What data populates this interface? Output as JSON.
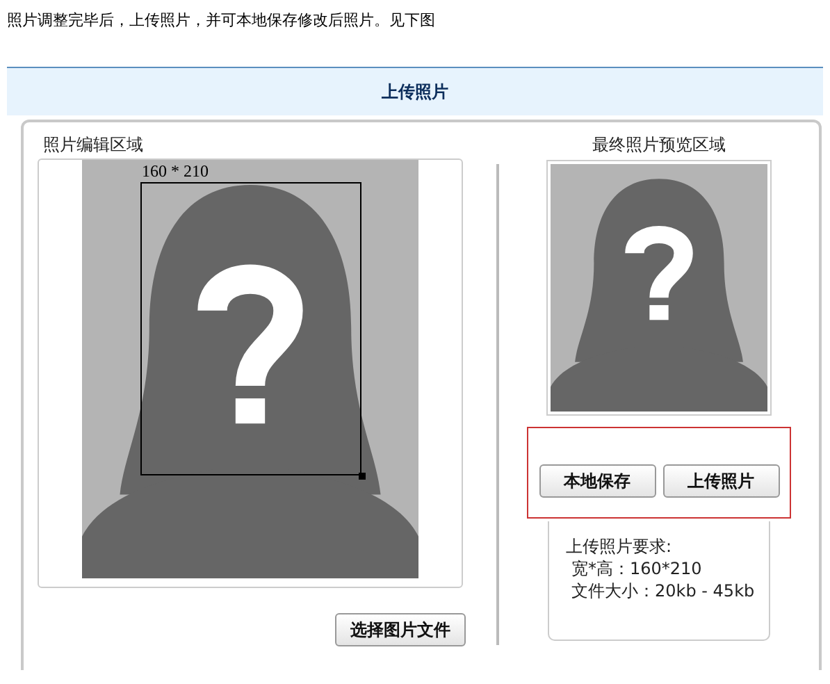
{
  "intro": "照片调整完毕后，上传照片，并可本地保存修改后照片。见下图",
  "header": {
    "title": "上传照片"
  },
  "editor": {
    "title": "照片编辑区域",
    "crop_label": "160 * 210",
    "button": "选择图片文件"
  },
  "preview": {
    "title": "最终照片预览区域",
    "buttons": [
      "本地保存",
      "上传照片"
    ],
    "requirements": {
      "title": "上传照片要求:",
      "lines": [
        "宽*高：160*210",
        "文件大小：20kb - 45kb"
      ]
    }
  }
}
